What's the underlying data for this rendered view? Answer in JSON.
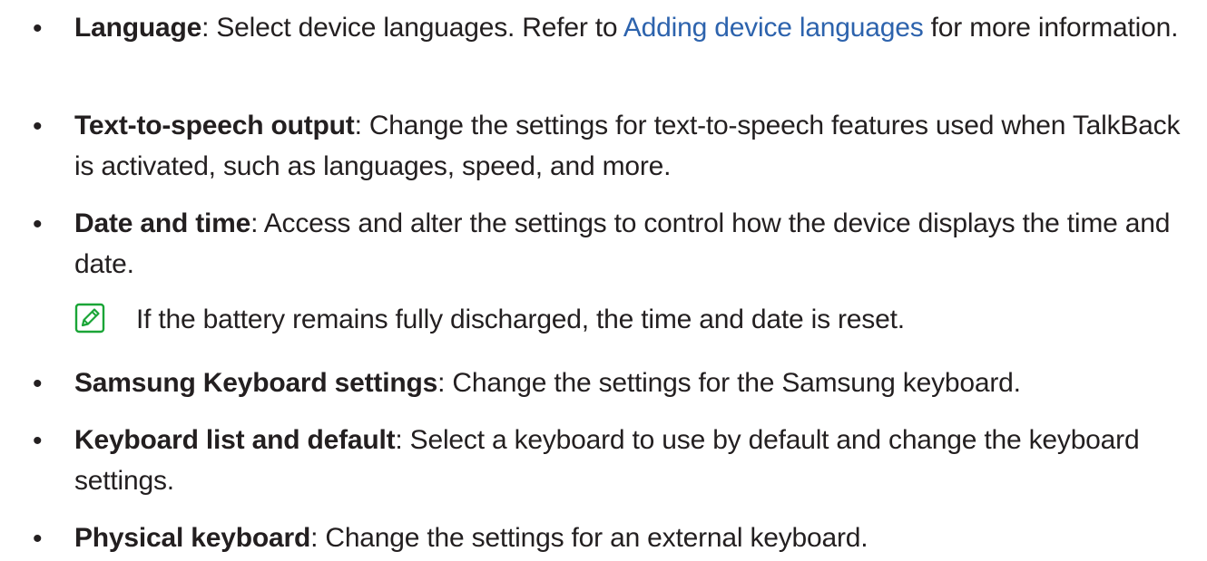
{
  "bullet_glyph": "•",
  "colors": {
    "text": "#231f20",
    "link": "#2d63ad",
    "note_icon": "#1aa537"
  },
  "items": [
    {
      "term": "Language",
      "desc_before": ": Select device languages. Refer to ",
      "link": "Adding device languages",
      "desc_after": " for more information."
    },
    {
      "term": "Text-to-speech output",
      "desc": ": Change the settings for text-to-speech features used when TalkBack is activated, such as languages, speed, and more."
    },
    {
      "term": "Date and time",
      "desc": ": Access and alter the settings to control how the device displays the time and date."
    },
    {
      "term": "Samsung Keyboard settings",
      "desc": ": Change the settings for the Samsung keyboard."
    },
    {
      "term": "Keyboard list and default",
      "desc": ": Select a keyboard to use by default and change the keyboard settings."
    },
    {
      "term": "Physical keyboard",
      "desc": ": Change the settings for an external keyboard."
    }
  ],
  "note": {
    "icon": "note-pencil-icon",
    "text": "If the battery remains fully discharged, the time and date is reset."
  }
}
